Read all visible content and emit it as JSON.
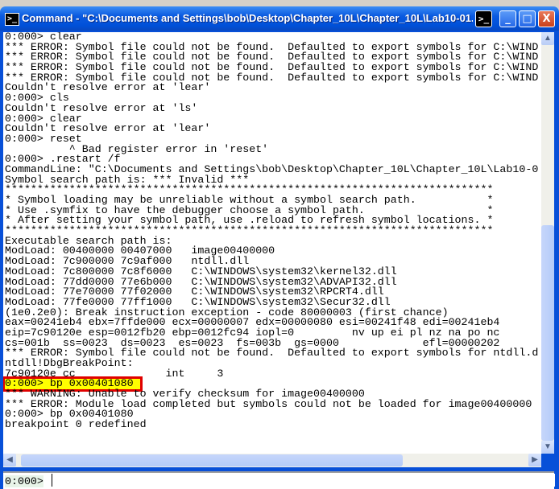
{
  "window": {
    "title": "Command - \"C:\\Documents and Settings\\bob\\Desktop\\Chapter_10L\\Chapter_10L\\Lab10-01.",
    "buttons": {
      "minimize": "_",
      "maximize": "□",
      "close": "X",
      "cmd": ">_"
    }
  },
  "output": {
    "lines": [
      "0:000> clear",
      "*** ERROR: Symbol file could not be found.  Defaulted to export symbols for C:\\WIND",
      "*** ERROR: Symbol file could not be found.  Defaulted to export symbols for C:\\WIND",
      "*** ERROR: Symbol file could not be found.  Defaulted to export symbols for C:\\WIND",
      "*** ERROR: Symbol file could not be found.  Defaulted to export symbols for C:\\WIND",
      "Couldn't resolve error at 'lear'",
      "0:000> cls",
      "Couldn't resolve error at 'ls'",
      "0:000> clear",
      "Couldn't resolve error at 'lear'",
      "0:000> reset",
      "          ^ Bad register error in 'reset'",
      "0:000> .restart /f",
      "CommandLine: \"C:\\Documents and Settings\\bob\\Desktop\\Chapter_10L\\Chapter_10L\\Lab10-0",
      "Symbol search path is: *** Invalid ***",
      "****************************************************************************",
      "* Symbol loading may be unreliable without a symbol search path.           *",
      "* Use .symfix to have the debugger choose a symbol path.                   *",
      "* After setting your symbol path, use .reload to refresh symbol locations. *",
      "****************************************************************************",
      "Executable search path is:",
      "ModLoad: 00400000 00407000   image00400000",
      "ModLoad: 7c900000 7c9af000   ntdll.dll",
      "ModLoad: 7c800000 7c8f6000   C:\\WINDOWS\\system32\\kernel32.dll",
      "ModLoad: 77dd0000 77e6b000   C:\\WINDOWS\\system32\\ADVAPI32.dll",
      "ModLoad: 77e70000 77f02000   C:\\WINDOWS\\system32\\RPCRT4.dll",
      "ModLoad: 77fe0000 77ff1000   C:\\WINDOWS\\system32\\Secur32.dll",
      "(1e0.2e0): Break instruction exception - code 80000003 (first chance)",
      "eax=00241eb4 ebx=7ffde000 ecx=00000007 edx=00000080 esi=00241f48 edi=00241eb4",
      "eip=7c90120e esp=0012fb20 ebp=0012fc94 iopl=0         nv up ei pl nz na po nc",
      "cs=001b  ss=0023  ds=0023  es=0023  fs=003b  gs=0000             efl=00000202",
      "*** ERROR: Symbol file could not be found.  Defaulted to export symbols for ntdll.d",
      "ntdll!DbgBreakPoint:",
      "7c90120e cc              int     3",
      "0:000> bp 0x00401080",
      "*** WARNING: Unable to verify checksum for image00400000",
      "*** ERROR: Module load completed but symbols could not be loaded for image00400000",
      "0:000> bp 0x00401080",
      "breakpoint 0 redefined"
    ],
    "highlighted_line": 34,
    "highlight_color": "#ffff00",
    "highlight_border": "#e00000"
  },
  "command": {
    "prompt": "0:000>",
    "value": ""
  }
}
